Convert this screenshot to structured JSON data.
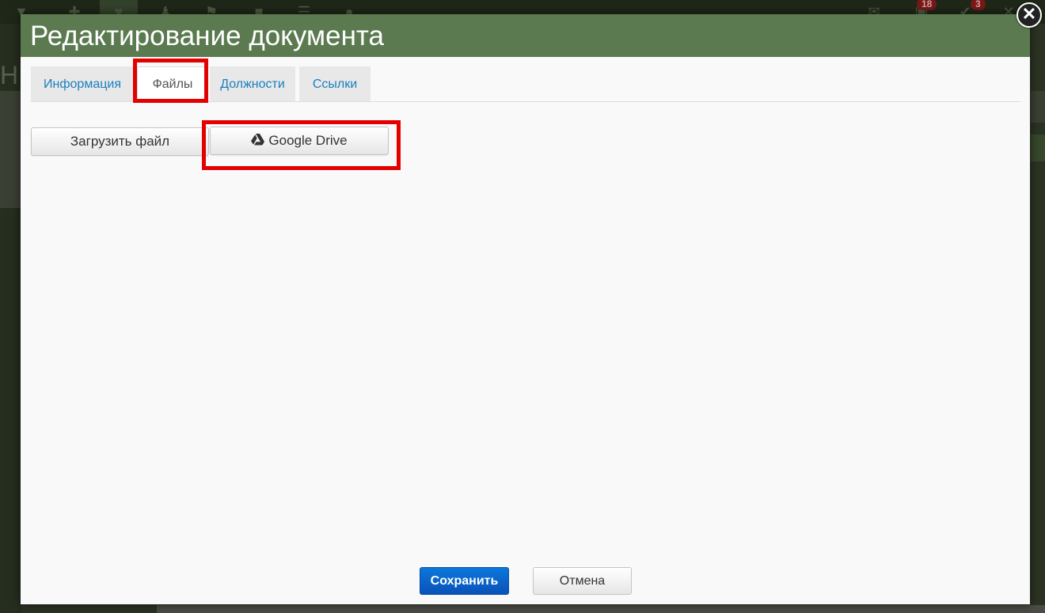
{
  "background": {
    "left_letter": "Н",
    "badges": [
      "18",
      "3"
    ]
  },
  "modal": {
    "title": "Редактирование документа",
    "close_symbol": "✕"
  },
  "tabs": [
    {
      "label": "Информация",
      "active": false
    },
    {
      "label": "Файлы",
      "active": true
    },
    {
      "label": "Должности",
      "active": false
    },
    {
      "label": "Ссылки",
      "active": false
    }
  ],
  "files": {
    "upload_label": "Загрузить файл",
    "gdrive_label": "Google Drive"
  },
  "footer": {
    "save_label": "Сохранить",
    "cancel_label": "Отмена"
  },
  "colors": {
    "header": "#5b7a50",
    "highlight": "#e30000",
    "primary": "#0a66cc",
    "link": "#1a7fc1"
  }
}
